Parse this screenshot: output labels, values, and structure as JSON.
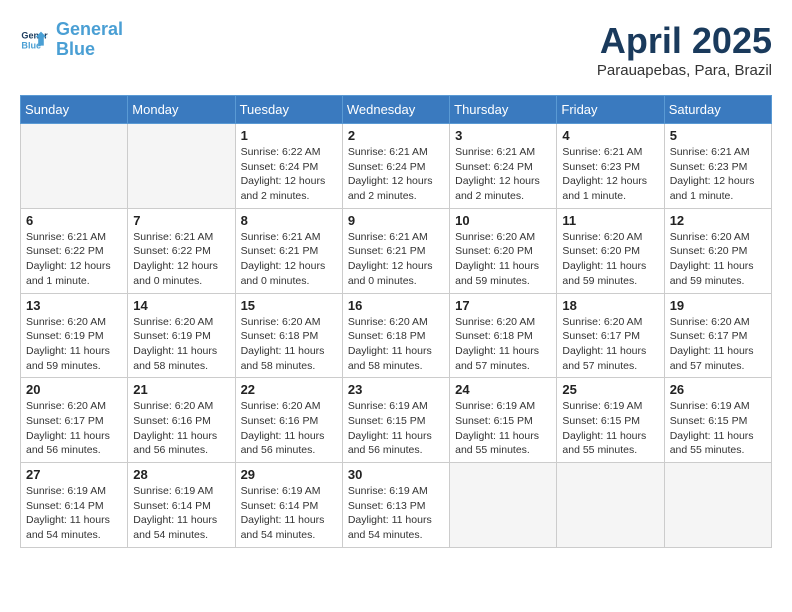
{
  "logo": {
    "line1": "General",
    "line2": "Blue"
  },
  "title": "April 2025",
  "subtitle": "Parauapebas, Para, Brazil",
  "days_of_week": [
    "Sunday",
    "Monday",
    "Tuesday",
    "Wednesday",
    "Thursday",
    "Friday",
    "Saturday"
  ],
  "weeks": [
    [
      {
        "empty": true
      },
      {
        "empty": true
      },
      {
        "day": 1,
        "sunrise": "6:22 AM",
        "sunset": "6:24 PM",
        "daylight": "12 hours and 2 minutes."
      },
      {
        "day": 2,
        "sunrise": "6:21 AM",
        "sunset": "6:24 PM",
        "daylight": "12 hours and 2 minutes."
      },
      {
        "day": 3,
        "sunrise": "6:21 AM",
        "sunset": "6:24 PM",
        "daylight": "12 hours and 2 minutes."
      },
      {
        "day": 4,
        "sunrise": "6:21 AM",
        "sunset": "6:23 PM",
        "daylight": "12 hours and 1 minute."
      },
      {
        "day": 5,
        "sunrise": "6:21 AM",
        "sunset": "6:23 PM",
        "daylight": "12 hours and 1 minute."
      }
    ],
    [
      {
        "day": 6,
        "sunrise": "6:21 AM",
        "sunset": "6:22 PM",
        "daylight": "12 hours and 1 minute."
      },
      {
        "day": 7,
        "sunrise": "6:21 AM",
        "sunset": "6:22 PM",
        "daylight": "12 hours and 0 minutes."
      },
      {
        "day": 8,
        "sunrise": "6:21 AM",
        "sunset": "6:21 PM",
        "daylight": "12 hours and 0 minutes."
      },
      {
        "day": 9,
        "sunrise": "6:21 AM",
        "sunset": "6:21 PM",
        "daylight": "12 hours and 0 minutes."
      },
      {
        "day": 10,
        "sunrise": "6:20 AM",
        "sunset": "6:20 PM",
        "daylight": "11 hours and 59 minutes."
      },
      {
        "day": 11,
        "sunrise": "6:20 AM",
        "sunset": "6:20 PM",
        "daylight": "11 hours and 59 minutes."
      },
      {
        "day": 12,
        "sunrise": "6:20 AM",
        "sunset": "6:20 PM",
        "daylight": "11 hours and 59 minutes."
      }
    ],
    [
      {
        "day": 13,
        "sunrise": "6:20 AM",
        "sunset": "6:19 PM",
        "daylight": "11 hours and 59 minutes."
      },
      {
        "day": 14,
        "sunrise": "6:20 AM",
        "sunset": "6:19 PM",
        "daylight": "11 hours and 58 minutes."
      },
      {
        "day": 15,
        "sunrise": "6:20 AM",
        "sunset": "6:18 PM",
        "daylight": "11 hours and 58 minutes."
      },
      {
        "day": 16,
        "sunrise": "6:20 AM",
        "sunset": "6:18 PM",
        "daylight": "11 hours and 58 minutes."
      },
      {
        "day": 17,
        "sunrise": "6:20 AM",
        "sunset": "6:18 PM",
        "daylight": "11 hours and 57 minutes."
      },
      {
        "day": 18,
        "sunrise": "6:20 AM",
        "sunset": "6:17 PM",
        "daylight": "11 hours and 57 minutes."
      },
      {
        "day": 19,
        "sunrise": "6:20 AM",
        "sunset": "6:17 PM",
        "daylight": "11 hours and 57 minutes."
      }
    ],
    [
      {
        "day": 20,
        "sunrise": "6:20 AM",
        "sunset": "6:17 PM",
        "daylight": "11 hours and 56 minutes."
      },
      {
        "day": 21,
        "sunrise": "6:20 AM",
        "sunset": "6:16 PM",
        "daylight": "11 hours and 56 minutes."
      },
      {
        "day": 22,
        "sunrise": "6:20 AM",
        "sunset": "6:16 PM",
        "daylight": "11 hours and 56 minutes."
      },
      {
        "day": 23,
        "sunrise": "6:19 AM",
        "sunset": "6:15 PM",
        "daylight": "11 hours and 56 minutes."
      },
      {
        "day": 24,
        "sunrise": "6:19 AM",
        "sunset": "6:15 PM",
        "daylight": "11 hours and 55 minutes."
      },
      {
        "day": 25,
        "sunrise": "6:19 AM",
        "sunset": "6:15 PM",
        "daylight": "11 hours and 55 minutes."
      },
      {
        "day": 26,
        "sunrise": "6:19 AM",
        "sunset": "6:15 PM",
        "daylight": "11 hours and 55 minutes."
      }
    ],
    [
      {
        "day": 27,
        "sunrise": "6:19 AM",
        "sunset": "6:14 PM",
        "daylight": "11 hours and 54 minutes."
      },
      {
        "day": 28,
        "sunrise": "6:19 AM",
        "sunset": "6:14 PM",
        "daylight": "11 hours and 54 minutes."
      },
      {
        "day": 29,
        "sunrise": "6:19 AM",
        "sunset": "6:14 PM",
        "daylight": "11 hours and 54 minutes."
      },
      {
        "day": 30,
        "sunrise": "6:19 AM",
        "sunset": "6:13 PM",
        "daylight": "11 hours and 54 minutes."
      },
      {
        "empty": true
      },
      {
        "empty": true
      },
      {
        "empty": true
      }
    ]
  ]
}
